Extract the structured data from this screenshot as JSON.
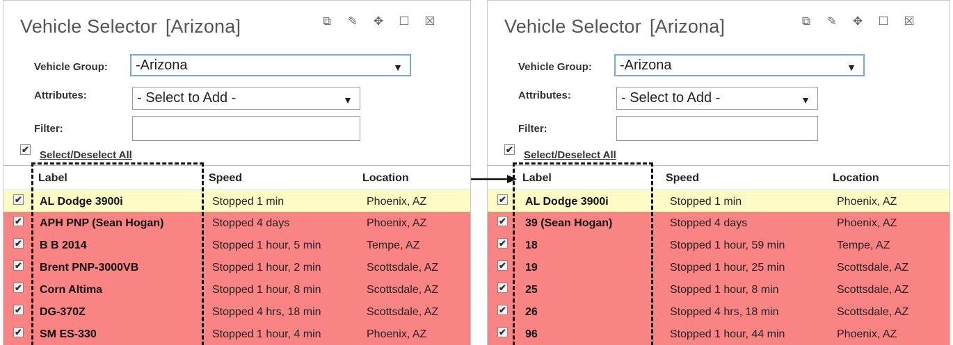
{
  "left": {
    "title": "Vehicle Selector",
    "subtitle": "[Arizona]",
    "vehicle_group_label": "Vehicle Group:",
    "vehicle_group_value": "-Arizona",
    "attributes_label": "Attributes:",
    "attributes_value": "- Select to Add -",
    "filter_label": "Filter:",
    "filter_value": "",
    "select_all": "Select/Deselect All",
    "columns": {
      "label": "Label",
      "speed": "Speed",
      "location": "Location"
    },
    "rows": [
      {
        "label": "AL Dodge 3900i",
        "speed": "Stopped 1 min",
        "location": "Phoenix, AZ",
        "status": "yellow"
      },
      {
        "label": "APH PNP (Sean Hogan)",
        "speed": "Stopped 4 days",
        "location": "Phoenix, AZ",
        "status": "red"
      },
      {
        "label": "B B 2014",
        "speed": "Stopped 1 hour, 5 min",
        "location": "Tempe, AZ",
        "status": "red"
      },
      {
        "label": "Brent PNP-3000VB",
        "speed": "Stopped 1 hour, 2 min",
        "location": "Scottsdale, AZ",
        "status": "red"
      },
      {
        "label": "Corn Altima",
        "speed": "Stopped 1 hour, 8 min",
        "location": "Scottsdale, AZ",
        "status": "red"
      },
      {
        "label": "DG-370Z",
        "speed": "Stopped 4 hrs, 18 min",
        "location": "Scottsdale, AZ",
        "status": "red"
      },
      {
        "label": "SM ES-330",
        "speed": "Stopped 1 hour, 4 min",
        "location": "Phoenix, AZ",
        "status": "red"
      }
    ]
  },
  "right": {
    "title": "Vehicle Selector",
    "subtitle": "[Arizona]",
    "vehicle_group_label": "Vehicle Group:",
    "vehicle_group_value": "-Arizona",
    "attributes_label": "Attributes:",
    "attributes_value": "- Select to Add -",
    "filter_label": "Filter:",
    "filter_value": "",
    "select_all": "Select/Deselect All",
    "columns": {
      "label": "Label",
      "speed": "Speed",
      "location": "Location"
    },
    "rows": [
      {
        "label": "AL Dodge 3900i",
        "speed": "Stopped 1 min",
        "location": "Phoenix, AZ",
        "status": "yellow"
      },
      {
        "label": "39 (Sean Hogan)",
        "speed": "Stopped 4 days",
        "location": "Phoenix, AZ",
        "status": "red"
      },
      {
        "label": "18",
        "speed": "Stopped 1 hour, 59 min",
        "location": "Tempe, AZ",
        "status": "red"
      },
      {
        "label": "19",
        "speed": "Stopped 1 hour, 25 min",
        "location": "Scottsdale, AZ",
        "status": "red"
      },
      {
        "label": "25",
        "speed": "Stopped 1 hour, 8 min",
        "location": "Scottsdale, AZ",
        "status": "red"
      },
      {
        "label": "26",
        "speed": "Stopped 4 hrs, 18 min",
        "location": "Scottsdale, AZ",
        "status": "red"
      },
      {
        "label": "96",
        "speed": "Stopped 1 hour, 44 min",
        "location": "Phoenix, AZ",
        "status": "red"
      }
    ]
  },
  "window_icons": [
    "copy-icon",
    "pencil-icon",
    "move-icon",
    "maximize-icon",
    "close-icon"
  ],
  "colors": {
    "row_red": "#f98484",
    "row_yellow": "#fdfcc4",
    "group_border": "#7aa6e8"
  }
}
